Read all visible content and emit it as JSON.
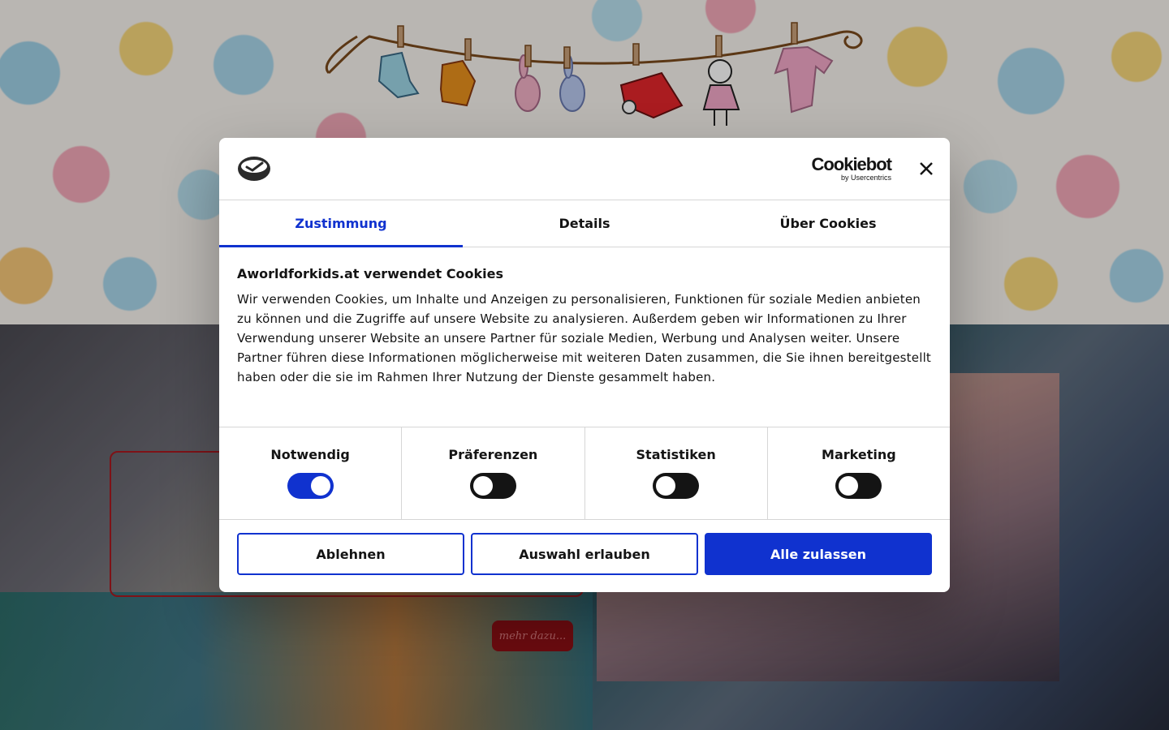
{
  "background": {
    "more_button_label": "mehr dazu..."
  },
  "dialog": {
    "close_label": "×",
    "cookiebot_wordmark": "Cookiebot",
    "cookiebot_byline": "by Usercentrics",
    "tabs": [
      {
        "label": "Zustimmung",
        "active": true
      },
      {
        "label": "Details",
        "active": false
      },
      {
        "label": "Über Cookies",
        "active": false
      }
    ],
    "heading": "Aworldforkids.at verwendet Cookies",
    "body": "Wir verwenden Cookies, um Inhalte und Anzeigen zu personalisieren, Funktionen für soziale Medien anbieten zu können und die Zugriffe auf unsere Website zu analysieren. Außerdem geben wir Informationen zu Ihrer Verwendung unserer Website an unsere Partner für soziale Medien, Werbung und Analysen weiter. Unsere Partner führen diese Informationen möglicherweise mit weiteren Daten zusammen, die Sie ihnen bereitgestellt haben oder die sie im Rahmen Ihrer Nutzung der Dienste gesammelt haben.",
    "toggles": [
      {
        "label": "Notwendig",
        "checked": true
      },
      {
        "label": "Präferenzen",
        "checked": false
      },
      {
        "label": "Statistiken",
        "checked": false
      },
      {
        "label": "Marketing",
        "checked": false
      }
    ],
    "buttons": {
      "decline": "Ablehnen",
      "allow_selection": "Auswahl erlauben",
      "allow_all": "Alle zulassen"
    },
    "accent_color": "#1032cf"
  }
}
